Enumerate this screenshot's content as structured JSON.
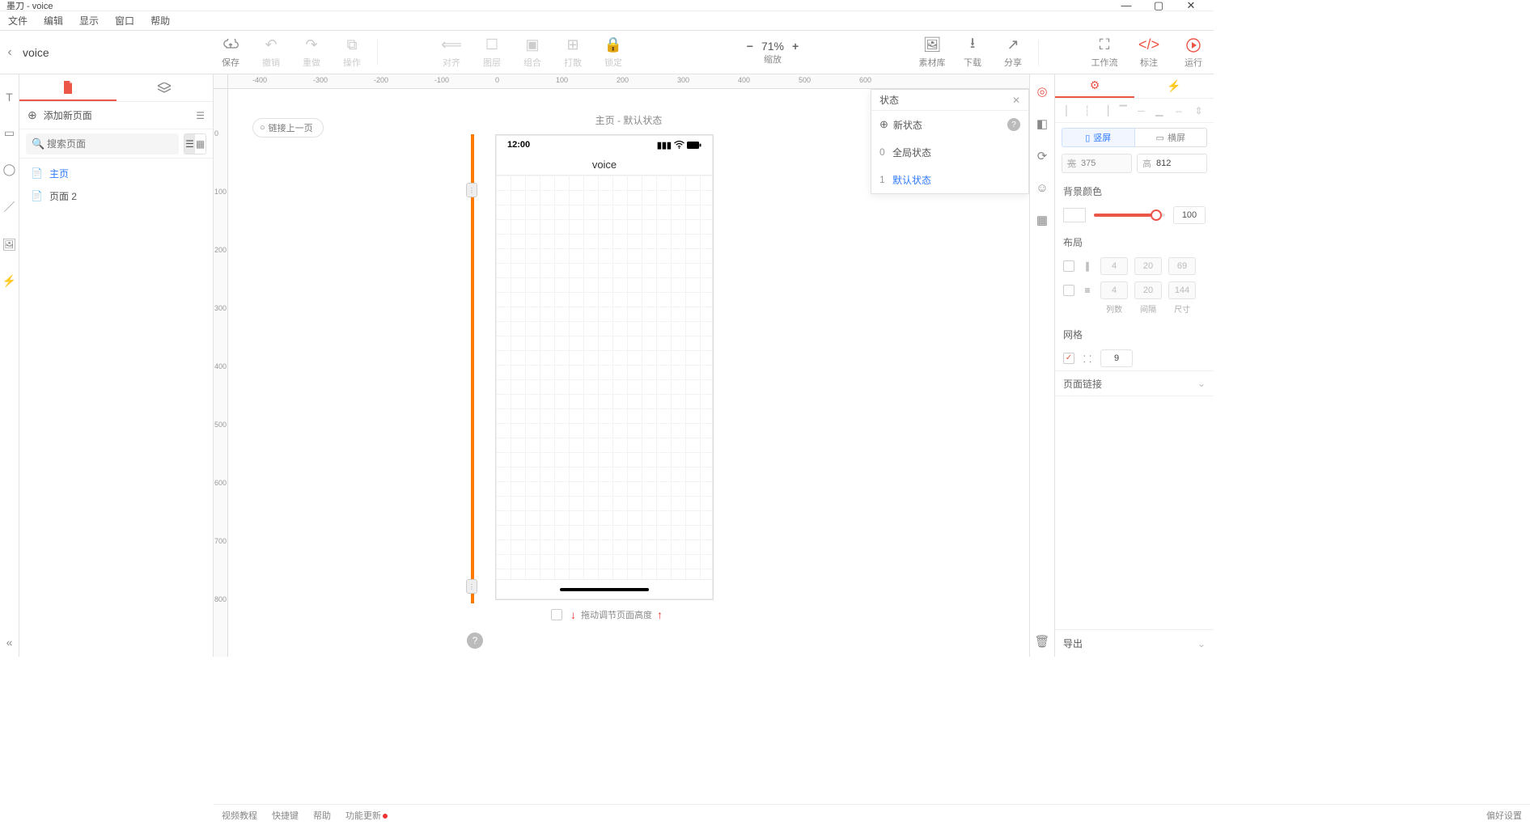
{
  "window": {
    "title": "墨刀 - voice"
  },
  "menubar": [
    "文件",
    "编辑",
    "显示",
    "窗口",
    "帮助"
  ],
  "project_name": "voice",
  "toolbar": {
    "save": "保存",
    "undo": "撤销",
    "redo": "重做",
    "operate": "操作",
    "align": "对齐",
    "layer": "图层",
    "group": "组合",
    "ungroup": "打散",
    "lock": "锁定",
    "assets": "素材库",
    "download": "下载",
    "share": "分享",
    "workflow": "工作流",
    "annotate": "标注",
    "run": "运行",
    "zoom_value": "71%",
    "zoom_label": "缩放"
  },
  "pages": {
    "add_label": "添加新页面",
    "search_placeholder": "搜索页面",
    "items": [
      {
        "label": "主页",
        "active": true
      },
      {
        "label": "页面 2",
        "active": false
      }
    ]
  },
  "canvas": {
    "link_prev": "链接上一页",
    "title": "主页 - 默认状态",
    "zoom": "71%",
    "device_time": "12:00",
    "device_title": "voice",
    "drag_hint": "拖动调节页面高度"
  },
  "states": {
    "header": "状态",
    "new_label": "新状态",
    "items": [
      {
        "index": "0",
        "label": "全局状态",
        "active": false
      },
      {
        "index": "1",
        "label": "默认状态",
        "active": true
      }
    ]
  },
  "props": {
    "orientation": {
      "portrait": "竖屏",
      "landscape": "横屏"
    },
    "width_label": "宽",
    "width_value": "375",
    "height_label": "高",
    "height_value": "812",
    "bg_title": "背景颜色",
    "opacity_value": "100",
    "layout_title": "布局",
    "cols": {
      "n": "4",
      "gap": "20",
      "size": "69"
    },
    "rows": {
      "n": "4",
      "gap": "20",
      "size": "144"
    },
    "layout_labels": [
      "列数",
      "间隔",
      "尺寸"
    ],
    "grid_title": "网格",
    "grid_value": "9",
    "page_link": "页面链接",
    "export": "导出"
  },
  "footer": {
    "video": "视频教程",
    "shortcut": "快捷键",
    "help": "帮助",
    "updates": "功能更新",
    "prefs": "偏好设置"
  }
}
